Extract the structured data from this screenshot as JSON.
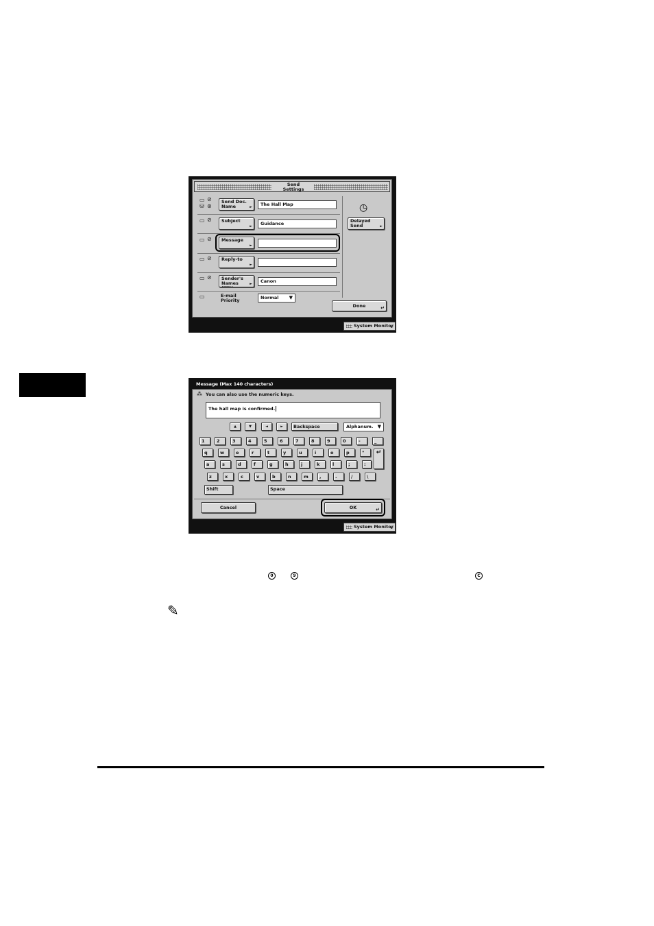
{
  "send_settings": {
    "title_line1": "Send",
    "title_line2": "Settings",
    "rows": [
      {
        "button": "Send Doc. Name",
        "value": "The Hall Map"
      },
      {
        "button": "Subject",
        "value": "Guidance"
      },
      {
        "button": "Message",
        "value": ""
      },
      {
        "button": "Reply-to",
        "value": ""
      },
      {
        "button": "Sender's Names (TTI)",
        "value": "Canon"
      }
    ],
    "priority_label": "E-mail Priority",
    "priority_value": "Normal",
    "delayed_send": "Delayed Send",
    "done": "Done",
    "system_monitor": "System Monitor"
  },
  "keyboard_screen": {
    "title": "Message (Max 140 characters)",
    "hint": "You can also use the numeric keys.",
    "input_value": "The hall map is confirmed.",
    "nav_keys": [
      "▲",
      "▼",
      "◄",
      "►"
    ],
    "backspace": "Backspace",
    "mode": "Alphanum.",
    "row1": [
      "1",
      "2",
      "3",
      "4",
      "5",
      "6",
      "7",
      "8",
      "9",
      "0",
      "-",
      "_"
    ],
    "row2": [
      "q",
      "w",
      "e",
      "r",
      "t",
      "y",
      "u",
      "i",
      "o",
      "p",
      "\"",
      "@"
    ],
    "row3": [
      "a",
      "s",
      "d",
      "f",
      "g",
      "h",
      "j",
      "k",
      "l",
      ";",
      ":"
    ],
    "row4": [
      "z",
      "x",
      "c",
      "v",
      "b",
      "n",
      "m",
      ",",
      ".",
      "/",
      "\\"
    ],
    "shift": "Shift",
    "space": "Space",
    "cancel": "Cancel",
    "ok": "OK",
    "system_monitor": "System Monitor"
  },
  "icons": {
    "enter": "↵",
    "clock": "◷",
    "dropdown": "▼",
    "arrow": "►",
    "pencil": "✎"
  },
  "symbols": [
    "0",
    "9",
    "C"
  ]
}
